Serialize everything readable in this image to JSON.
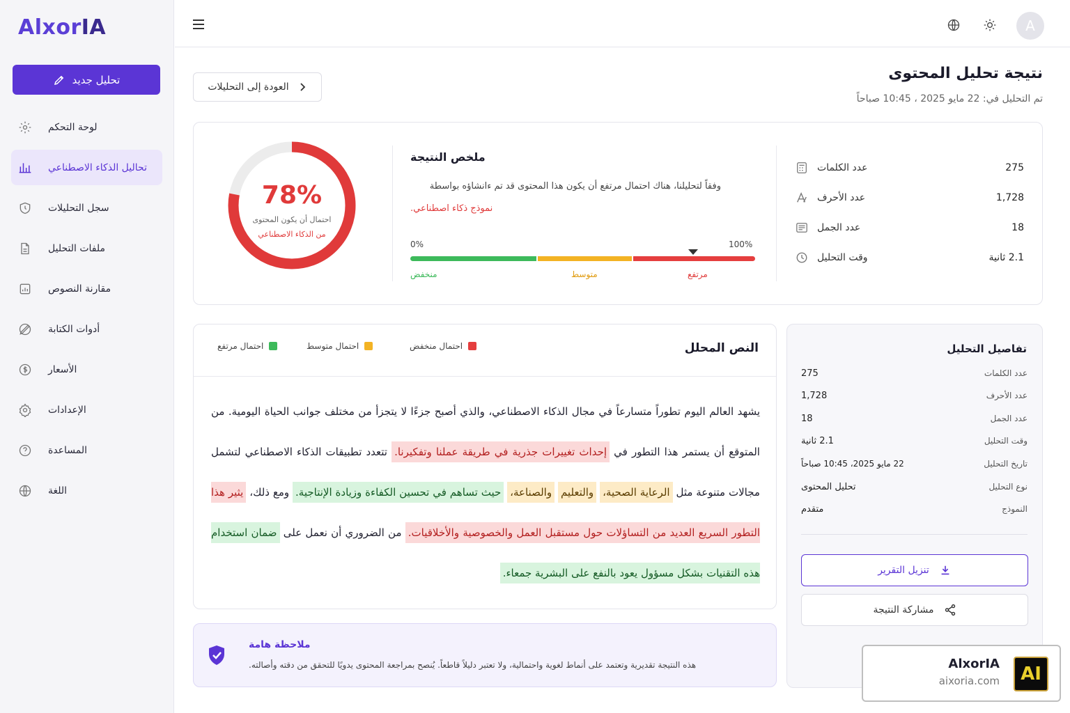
{
  "app": {
    "logo_light": "Alxor",
    "logo_dark": "IA"
  },
  "sidebar": {
    "new_label": "تحليل جديد",
    "items": [
      {
        "label": "لوحة التحكم",
        "icon": "gear-icon"
      },
      {
        "label": "تحاليل الذكاء الاصطناعي",
        "icon": "bar-chart-icon",
        "active": true
      },
      {
        "label": "سجل التحليلات",
        "icon": "shield-clock-icon"
      },
      {
        "label": "ملفات التحليل",
        "icon": "file-icon"
      },
      {
        "label": "مقارنة النصوص",
        "icon": "compare-icon"
      },
      {
        "label": "أدوات الكتابة",
        "icon": "pen-icon"
      },
      {
        "label": "الأسعار",
        "icon": "dollar-icon"
      },
      {
        "label": "الإعدادات",
        "icon": "settings-icon"
      },
      {
        "label": "المساعدة",
        "icon": "help-icon"
      },
      {
        "label": "اللغة",
        "icon": "globe-icon"
      }
    ]
  },
  "topbar": {
    "avatar_letter": "A"
  },
  "header": {
    "title": "نتيجة تحليل المحتوى",
    "date": "تم التحليل في: 22 مايو 2025 ، 10:45 صباحاً",
    "back_label": "العودة إلى التحليلات"
  },
  "summary": {
    "percent": 78,
    "percent_label": "78%",
    "caption1": "احتمال أن يكون المحتوى",
    "caption2": "من الذكاء الاصطناعي",
    "title": "ملخص النتيجة",
    "text1": "وفقاً لتحليلنا، هناك احتمال مرتفع أن يكون هذا المحتوى قد تم ءانشاؤه بواسطة",
    "text2": "نموذج ذكاء اصطناعي.",
    "scale_min": "0%",
    "scale_max": "100%",
    "low": "منخفض",
    "mid": "متوسط",
    "high": "مرتفع",
    "colors": {
      "low": "#3dba5b",
      "mid": "#f3b324",
      "high": "#e53e3e"
    }
  },
  "stats": [
    {
      "label": "عدد الكلمات",
      "value": "275",
      "icon": "calculator-icon"
    },
    {
      "label": "عدد الأحرف",
      "value": "1,728",
      "icon": "text-letters-icon"
    },
    {
      "label": "عدد الجمل",
      "value": "18",
      "icon": "lines-icon"
    },
    {
      "label": "وقت التحليل",
      "value": "2.1 ثانية",
      "icon": "clock-icon"
    }
  ],
  "analyzed": {
    "title": "النص المحلل",
    "legend": [
      {
        "label": "احتمال منخفض",
        "color": "#e53e3e"
      },
      {
        "label": "احتمال متوسط",
        "color": "#f3b324"
      },
      {
        "label": "احتمال مرتفع",
        "color": "#3dba5b"
      }
    ],
    "segments": [
      {
        "t": "يشهد العالم اليوم تطوراً متسارعاً في مجال الذكاء الاصطناعي، والذي أصبح جزءًا لا يتجزأ من مختلف جوانب الحياة اليومية. من المتوقع أن يستمر هذا التطور في ",
        "h": ""
      },
      {
        "t": "إحداث تغييرات جذرية في طريقة عملنا وتفكيرنا.",
        "h": "r"
      },
      {
        "t": " تتعدد تطبيقات الذكاء الاصطناعي لتشمل مجالات متنوعة مثل ",
        "h": ""
      },
      {
        "t": "الرعاية الصحية،",
        "h": "y"
      },
      {
        "t": " ",
        "h": ""
      },
      {
        "t": "والتعليم",
        "h": "y"
      },
      {
        "t": " ",
        "h": ""
      },
      {
        "t": "والصناعة،",
        "h": "y"
      },
      {
        "t": " ",
        "h": ""
      },
      {
        "t": "حيث تساهم في تحسين الكفاءة وزيادة الإنتاجية.",
        "h": "g"
      },
      {
        "t": " ومع ذلك، ",
        "h": ""
      },
      {
        "t": "يثير هذا التطور السريع العديد من التساؤلات حول مستقبل العمل والخصوصية والأخلاقيات.",
        "h": "r"
      },
      {
        "t": " من الضروري أن نعمل على ",
        "h": ""
      },
      {
        "t": "ضمان استخدام هذه التقنيات بشكل مسؤول يعود بالنفع على البشرية جمعاء.",
        "h": "g"
      }
    ]
  },
  "note": {
    "title": "ملاحظة هامة",
    "text": "هذه النتيجة تقديرية وتعتمد على أنماط لغوية واحتمالية، ولا تعتبر دليلاً قاطعاً. يُنصح بمراجعة المحتوى يدويًا للتحقق من دقته وأصالته."
  },
  "details": {
    "title": "تفاصيل التحليل",
    "rows": [
      {
        "label": "عدد الكلمات",
        "value": "275"
      },
      {
        "label": "عدد الأحرف",
        "value": "1,728"
      },
      {
        "label": "عدد الجمل",
        "value": "18"
      },
      {
        "label": "وقت التحليل",
        "value": "2.1 ثانية"
      },
      {
        "label": "تاريخ التحليل",
        "value": "22 مايو 2025، 10:45 صباحاً"
      },
      {
        "label": "نوع التحليل",
        "value": "تحليل المحتوى"
      },
      {
        "label": "النموذج",
        "value": "متقدم"
      }
    ],
    "download_label": "تنزيل التقرير",
    "share_label": "مشاركة النتيجة"
  },
  "watermark": {
    "name": "AlxorIA",
    "url": "aixoria.com",
    "badge": "AI"
  }
}
